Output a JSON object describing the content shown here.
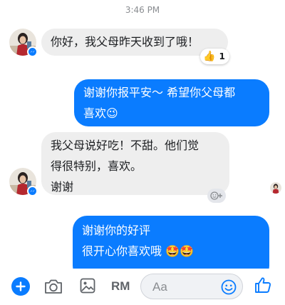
{
  "status": {
    "time": "3:46 PM"
  },
  "messages": [
    {
      "direction": "incoming",
      "lines": [
        "你好，我父母昨天收到了哦！"
      ]
    },
    {
      "direction": "outgoing",
      "lines": [
        "谢谢你报平安～ 希望你父母都",
        "喜欢😉"
      ]
    },
    {
      "direction": "incoming",
      "lines": [
        "我父母说好吃！不甜。他们觉",
        "得很特别，喜欢。",
        "谢谢"
      ]
    },
    {
      "direction": "outgoing",
      "lines": [
        "谢谢你的好评",
        "很开心你喜欢哦 🤩🤩"
      ]
    }
  ],
  "reaction": {
    "icon": "thumbs-up-icon",
    "count": "1"
  },
  "composer": {
    "rm_label": "RM",
    "placeholder": "Aa",
    "icons": [
      "plus-icon",
      "camera-icon",
      "gallery-icon",
      "emoji-icon",
      "thumbs-up-icon"
    ]
  },
  "colors": {
    "outgoing_bubble": "#0a7cff",
    "incoming_bubble": "#eeeeee",
    "accent": "#0a7cff"
  }
}
